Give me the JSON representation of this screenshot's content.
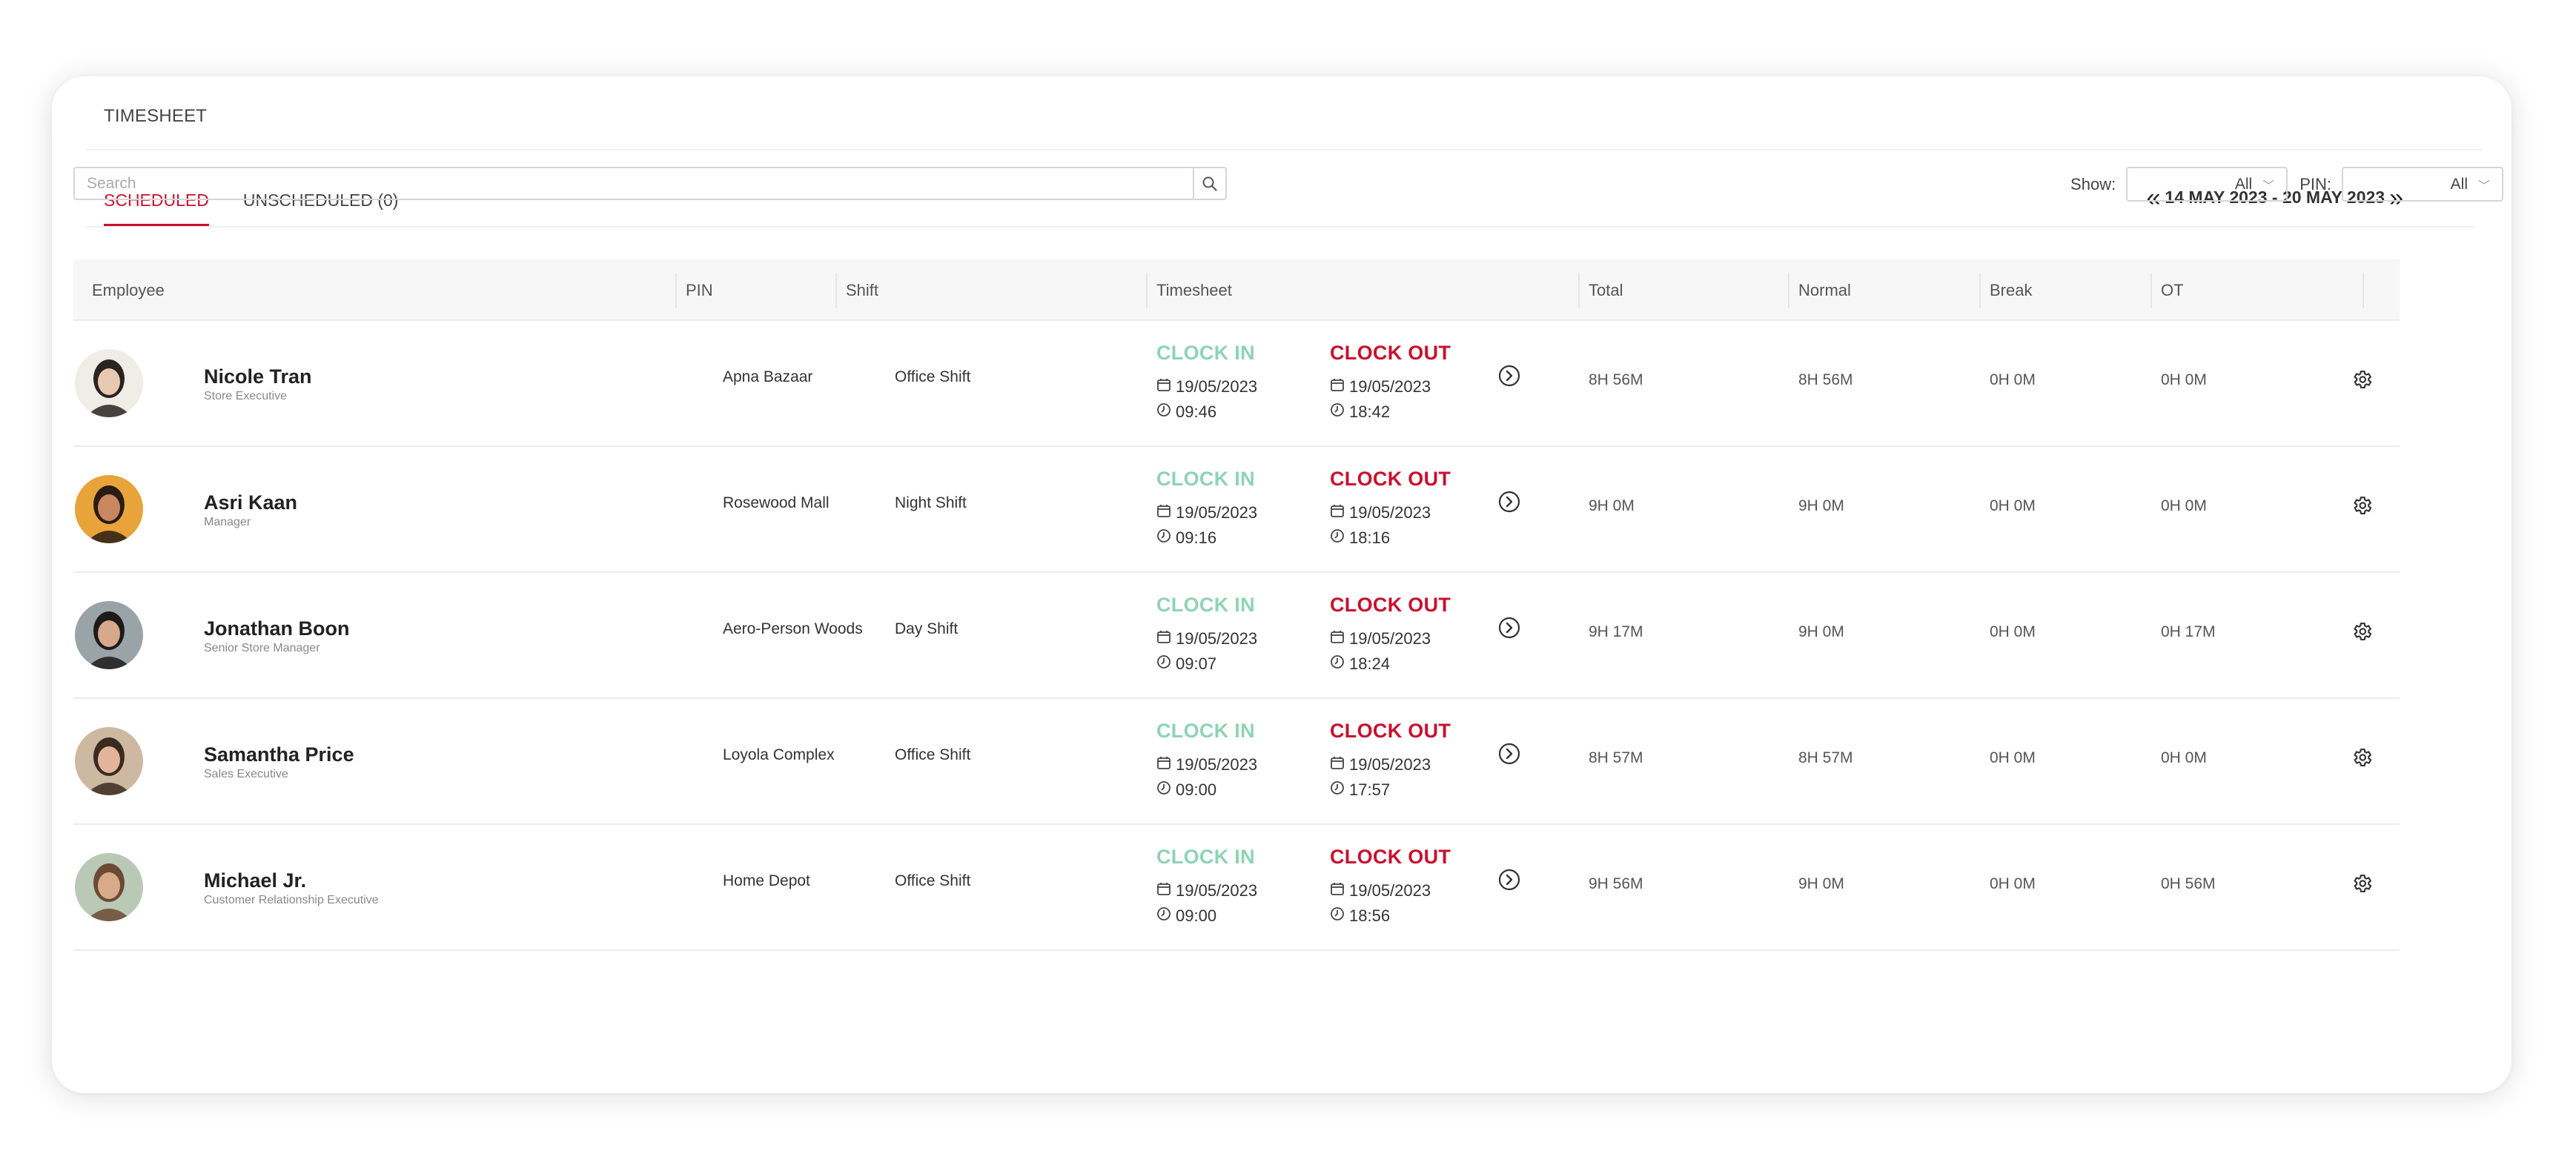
{
  "header": {
    "title": "TIMESHEET"
  },
  "tabs": [
    {
      "label": "SCHEDULED",
      "active": true
    },
    {
      "label": "UNSCHEDULED (0)",
      "active": false
    }
  ],
  "date_range": {
    "label": "14 MAY 2023 - 20 MAY 2023"
  },
  "search": {
    "placeholder": "Search",
    "value": ""
  },
  "filters": {
    "show_label": "Show:",
    "show_value": "All",
    "pin_label": "PIN:",
    "pin_value": "All"
  },
  "columns": {
    "employee": "Employee",
    "pin": "PIN",
    "shift": "Shift",
    "timesheet": "Timesheet",
    "total": "Total",
    "normal": "Normal",
    "break": "Break",
    "ot": "OT"
  },
  "labels": {
    "clock_in": "CLOCK IN",
    "clock_out": "CLOCK OUT"
  },
  "colors": {
    "accent": "#c8102e",
    "clock_in": "#8fd3b4"
  },
  "rows": [
    {
      "name": "Nicole Tran",
      "role": "Store Executive",
      "pin": "Apna Bazaar",
      "shift": "Office Shift",
      "in_date": "19/05/2023",
      "in_time": "09:46",
      "out_date": "19/05/2023",
      "out_time": "18:42",
      "total": "8H 56M",
      "normal": "8H 56M",
      "break": "0H 0M",
      "ot": "0H 0M"
    },
    {
      "name": "Asri Kaan",
      "role": "Manager",
      "pin": "Rosewood Mall",
      "shift": "Night Shift",
      "in_date": "19/05/2023",
      "in_time": "09:16",
      "out_date": "19/05/2023",
      "out_time": "18:16",
      "total": "9H 0M",
      "normal": "9H 0M",
      "break": "0H 0M",
      "ot": "0H 0M"
    },
    {
      "name": "Jonathan Boon",
      "role": "Senior Store Manager",
      "pin": "Aero-Person Woods",
      "shift": "Day Shift",
      "in_date": "19/05/2023",
      "in_time": "09:07",
      "out_date": "19/05/2023",
      "out_time": "18:24",
      "total": "9H 17M",
      "normal": "9H 0M",
      "break": "0H 0M",
      "ot": "0H 17M"
    },
    {
      "name": "Samantha Price",
      "role": "Sales Executive",
      "pin": "Loyola Complex",
      "shift": "Office Shift",
      "in_date": "19/05/2023",
      "in_time": "09:00",
      "out_date": "19/05/2023",
      "out_time": "17:57",
      "total": "8H 57M",
      "normal": "8H 57M",
      "break": "0H 0M",
      "ot": "0H 0M"
    },
    {
      "name": "Michael Jr.",
      "role": "Customer Relationship Executive",
      "pin": "Home Depot",
      "shift": "Office Shift",
      "in_date": "19/05/2023",
      "in_time": "09:00",
      "out_date": "19/05/2023",
      "out_time": "18:56",
      "total": "9H 56M",
      "normal": "9H 0M",
      "break": "0H 0M",
      "ot": "0H 56M"
    }
  ]
}
